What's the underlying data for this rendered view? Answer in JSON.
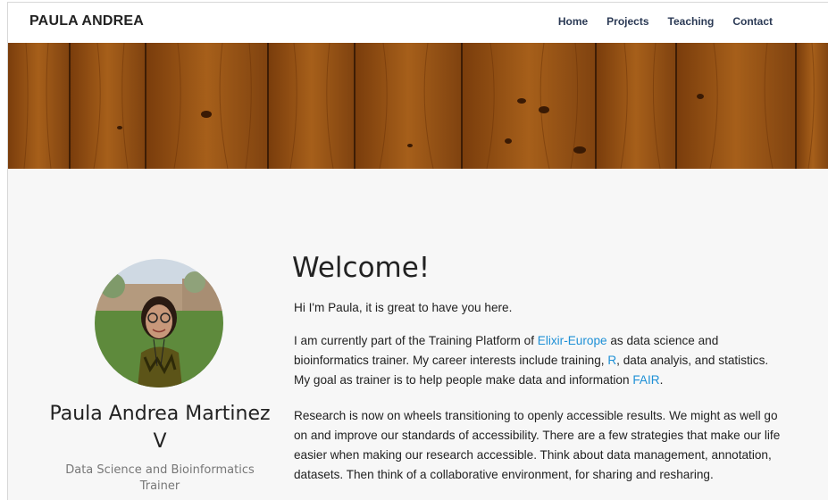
{
  "nav": {
    "brand": "PAULA ANDREA",
    "links": [
      {
        "label": "Home"
      },
      {
        "label": "Projects"
      },
      {
        "label": "Teaching"
      },
      {
        "label": "Contact"
      }
    ]
  },
  "profile": {
    "name": "Paula Andrea Martinez V",
    "role": "Data Science and Bioinformatics Trainer"
  },
  "main": {
    "title": "Welcome!",
    "intro": "Hi I'm Paula, it is great to have you here.",
    "p1": {
      "t1": "I am currently part of the Training Platform of ",
      "link1": "Elixir-Europe",
      "t2": " as data science and bioinformatics trainer. My career interests include training, ",
      "link2": "R",
      "t3": ", data analyis, and statistics. My goal as trainer is to help people make data and information ",
      "link3": "FAIR",
      "t4": "."
    },
    "p2": "Research is now on wheels transitioning to openly accessible results. We might as well go on and improve our standards of accessibility. There are a few strategies that make our life easier when making our research accessible. Think about data management, annotation, datasets. Then think of a collaborative environment, for sharing and resharing."
  },
  "colors": {
    "link": "#1e90d6",
    "nav_text": "#2b3a55",
    "background": "#f7f7f7",
    "wood": "#9a5415"
  }
}
